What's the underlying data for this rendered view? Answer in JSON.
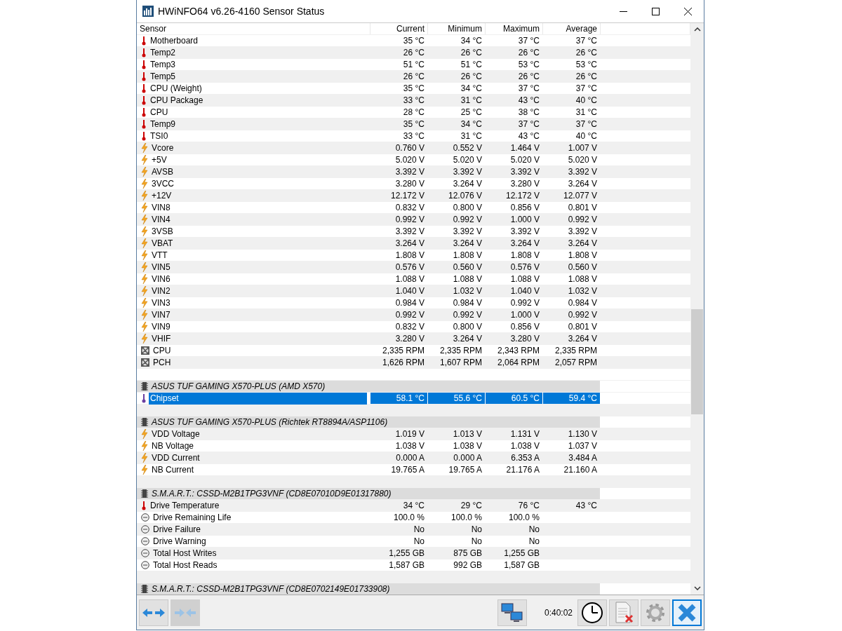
{
  "window": {
    "title": "HWiNFO64 v6.26-4160 Sensor Status"
  },
  "table": {
    "columns": [
      "Sensor",
      "Current",
      "Minimum",
      "Maximum",
      "Average"
    ],
    "rows": [
      {
        "kind": "temperature",
        "name": "Motherboard",
        "values": [
          "35 °C",
          "34 °C",
          "37 °C",
          "37 °C"
        ],
        "selected": false
      },
      {
        "kind": "temperature",
        "name": "Temp2",
        "values": [
          "26 °C",
          "26 °C",
          "26 °C",
          "26 °C"
        ],
        "selected": false
      },
      {
        "kind": "temperature",
        "name": "Temp3",
        "values": [
          "51 °C",
          "51 °C",
          "53 °C",
          "53 °C"
        ],
        "selected": false
      },
      {
        "kind": "temperature",
        "name": "Temp5",
        "values": [
          "26 °C",
          "26 °C",
          "26 °C",
          "26 °C"
        ],
        "selected": false
      },
      {
        "kind": "temperature",
        "name": "CPU (Weight)",
        "values": [
          "35 °C",
          "34 °C",
          "37 °C",
          "37 °C"
        ],
        "selected": false
      },
      {
        "kind": "temperature",
        "name": "CPU Package",
        "values": [
          "33 °C",
          "31 °C",
          "43 °C",
          "40 °C"
        ],
        "selected": false
      },
      {
        "kind": "temperature",
        "name": "CPU",
        "values": [
          "28 °C",
          "25 °C",
          "38 °C",
          "31 °C"
        ],
        "selected": false
      },
      {
        "kind": "temperature",
        "name": "Temp9",
        "values": [
          "35 °C",
          "34 °C",
          "37 °C",
          "37 °C"
        ],
        "selected": false
      },
      {
        "kind": "temperature",
        "name": "TSI0",
        "values": [
          "33 °C",
          "31 °C",
          "43 °C",
          "40 °C"
        ],
        "selected": false
      },
      {
        "kind": "voltage",
        "name": "Vcore",
        "values": [
          "0.760 V",
          "0.552 V",
          "1.464 V",
          "1.007 V"
        ],
        "selected": false
      },
      {
        "kind": "voltage",
        "name": "+5V",
        "values": [
          "5.020 V",
          "5.020 V",
          "5.020 V",
          "5.020 V"
        ],
        "selected": false
      },
      {
        "kind": "voltage",
        "name": "AVSB",
        "values": [
          "3.392 V",
          "3.392 V",
          "3.392 V",
          "3.392 V"
        ],
        "selected": false
      },
      {
        "kind": "voltage",
        "name": "3VCC",
        "values": [
          "3.280 V",
          "3.264 V",
          "3.280 V",
          "3.264 V"
        ],
        "selected": false
      },
      {
        "kind": "voltage",
        "name": "+12V",
        "values": [
          "12.172 V",
          "12.076 V",
          "12.172 V",
          "12.077 V"
        ],
        "selected": false
      },
      {
        "kind": "voltage",
        "name": "VIN8",
        "values": [
          "0.832 V",
          "0.800 V",
          "0.856 V",
          "0.801 V"
        ],
        "selected": false
      },
      {
        "kind": "voltage",
        "name": "VIN4",
        "values": [
          "0.992 V",
          "0.992 V",
          "1.000 V",
          "0.992 V"
        ],
        "selected": false
      },
      {
        "kind": "voltage",
        "name": "3VSB",
        "values": [
          "3.392 V",
          "3.392 V",
          "3.392 V",
          "3.392 V"
        ],
        "selected": false
      },
      {
        "kind": "voltage",
        "name": "VBAT",
        "values": [
          "3.264 V",
          "3.264 V",
          "3.264 V",
          "3.264 V"
        ],
        "selected": false
      },
      {
        "kind": "voltage",
        "name": "VTT",
        "values": [
          "1.808 V",
          "1.808 V",
          "1.808 V",
          "1.808 V"
        ],
        "selected": false
      },
      {
        "kind": "voltage",
        "name": "VIN5",
        "values": [
          "0.576 V",
          "0.560 V",
          "0.576 V",
          "0.560 V"
        ],
        "selected": false
      },
      {
        "kind": "voltage",
        "name": "VIN6",
        "values": [
          "1.088 V",
          "1.088 V",
          "1.088 V",
          "1.088 V"
        ],
        "selected": false
      },
      {
        "kind": "voltage",
        "name": "VIN2",
        "values": [
          "1.040 V",
          "1.032 V",
          "1.040 V",
          "1.032 V"
        ],
        "selected": false
      },
      {
        "kind": "voltage",
        "name": "VIN3",
        "values": [
          "0.984 V",
          "0.984 V",
          "0.992 V",
          "0.984 V"
        ],
        "selected": false
      },
      {
        "kind": "voltage",
        "name": "VIN7",
        "values": [
          "0.992 V",
          "0.992 V",
          "1.000 V",
          "0.992 V"
        ],
        "selected": false
      },
      {
        "kind": "voltage",
        "name": "VIN9",
        "values": [
          "0.832 V",
          "0.800 V",
          "0.856 V",
          "0.801 V"
        ],
        "selected": false
      },
      {
        "kind": "voltage",
        "name": "VHIF",
        "values": [
          "3.280 V",
          "3.264 V",
          "3.280 V",
          "3.264 V"
        ],
        "selected": false
      },
      {
        "kind": "fan",
        "name": "CPU",
        "values": [
          "2,335 RPM",
          "2,335 RPM",
          "2,343 RPM",
          "2,335 RPM"
        ],
        "selected": false
      },
      {
        "kind": "fan",
        "name": "PCH",
        "values": [
          "1,626 RPM",
          "1,607 RPM",
          "2,064 RPM",
          "2,057 RPM"
        ],
        "selected": false
      },
      {
        "kind": "blank",
        "selected": false
      },
      {
        "kind": "group",
        "name": "ASUS TUF GAMING X570-PLUS (AMD X570)",
        "selected": false
      },
      {
        "kind": "temperature",
        "name": "Chipset",
        "values": [
          "58.1 °C",
          "55.6 °C",
          "60.5 °C",
          "59.4 °C"
        ],
        "selected": true
      },
      {
        "kind": "blank",
        "selected": false
      },
      {
        "kind": "group",
        "name": "ASUS TUF GAMING X570-PLUS (Richtek RT8894A/ASP1106)",
        "selected": false
      },
      {
        "kind": "voltage",
        "name": "VDD Voltage",
        "values": [
          "1.019 V",
          "1.013 V",
          "1.131 V",
          "1.130 V"
        ],
        "selected": false
      },
      {
        "kind": "voltage",
        "name": "NB Voltage",
        "values": [
          "1.038 V",
          "1.038 V",
          "1.038 V",
          "1.037 V"
        ],
        "selected": false
      },
      {
        "kind": "voltage",
        "name": "VDD Current",
        "values": [
          "0.000 A",
          "0.000 A",
          "6.353 A",
          "3.484 A"
        ],
        "selected": false
      },
      {
        "kind": "voltage",
        "name": "NB Current",
        "values": [
          "19.765 A",
          "19.765 A",
          "21.176 A",
          "21.160 A"
        ],
        "selected": false
      },
      {
        "kind": "blank",
        "selected": false
      },
      {
        "kind": "group",
        "name": "S.M.A.R.T.: CSSD-M2B1TPG3VNF (CD8E07010D9E01317880)",
        "selected": false
      },
      {
        "kind": "temperature",
        "name": "Drive Temperature",
        "values": [
          "34 °C",
          "29 °C",
          "76 °C",
          "43 °C"
        ],
        "selected": false
      },
      {
        "kind": "status",
        "name": "Drive Remaining Life",
        "values": [
          "100.0 %",
          "100.0 %",
          "100.0 %"
        ],
        "selected": false
      },
      {
        "kind": "status",
        "name": "Drive Failure",
        "values": [
          "No",
          "No",
          "No"
        ],
        "selected": false
      },
      {
        "kind": "status",
        "name": "Drive Warning",
        "values": [
          "No",
          "No",
          "No"
        ],
        "selected": false
      },
      {
        "kind": "status",
        "name": "Total Host Writes",
        "values": [
          "1,255 GB",
          "875 GB",
          "1,255 GB"
        ],
        "selected": false
      },
      {
        "kind": "status",
        "name": "Total Host Reads",
        "values": [
          "1,587 GB",
          "992 GB",
          "1,587 GB"
        ],
        "selected": false
      },
      {
        "kind": "blank",
        "selected": false
      },
      {
        "kind": "group",
        "name": "S.M.A.R.T.: CSSD-M2B1TPG3VNF (CD8E0702149E01733908)",
        "selected": false
      }
    ]
  },
  "toolbar": {
    "left": [
      {
        "kind": "expand",
        "disabled": false
      },
      {
        "kind": "collapse",
        "disabled": true
      }
    ],
    "right": [
      {
        "kind": "network"
      },
      {
        "kind": "time",
        "text": "0:40:02"
      },
      {
        "kind": "clock"
      },
      {
        "kind": "report"
      },
      {
        "kind": "settings"
      },
      {
        "kind": "close"
      }
    ]
  }
}
